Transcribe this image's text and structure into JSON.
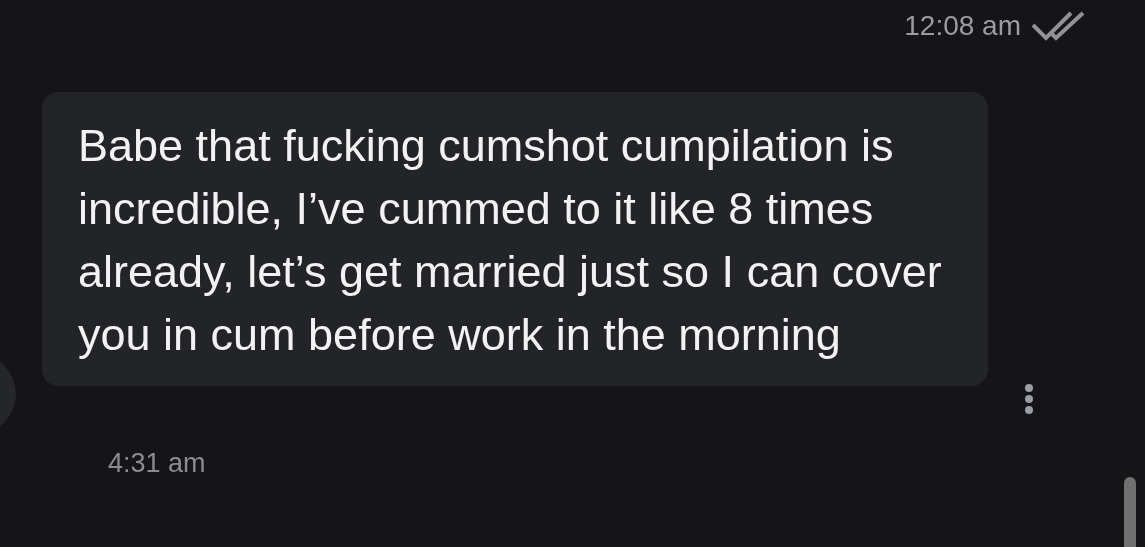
{
  "messages": [
    {
      "kind": "outgoing",
      "time": "12:08 am",
      "read": true
    },
    {
      "kind": "incoming",
      "text": "Babe that fucking cumshot cumpilation is incredible, I’ve cummed to it like 8 times already, let’s get married just so I can cover you in cum before work in the morning",
      "time": "4:31 am"
    }
  ]
}
